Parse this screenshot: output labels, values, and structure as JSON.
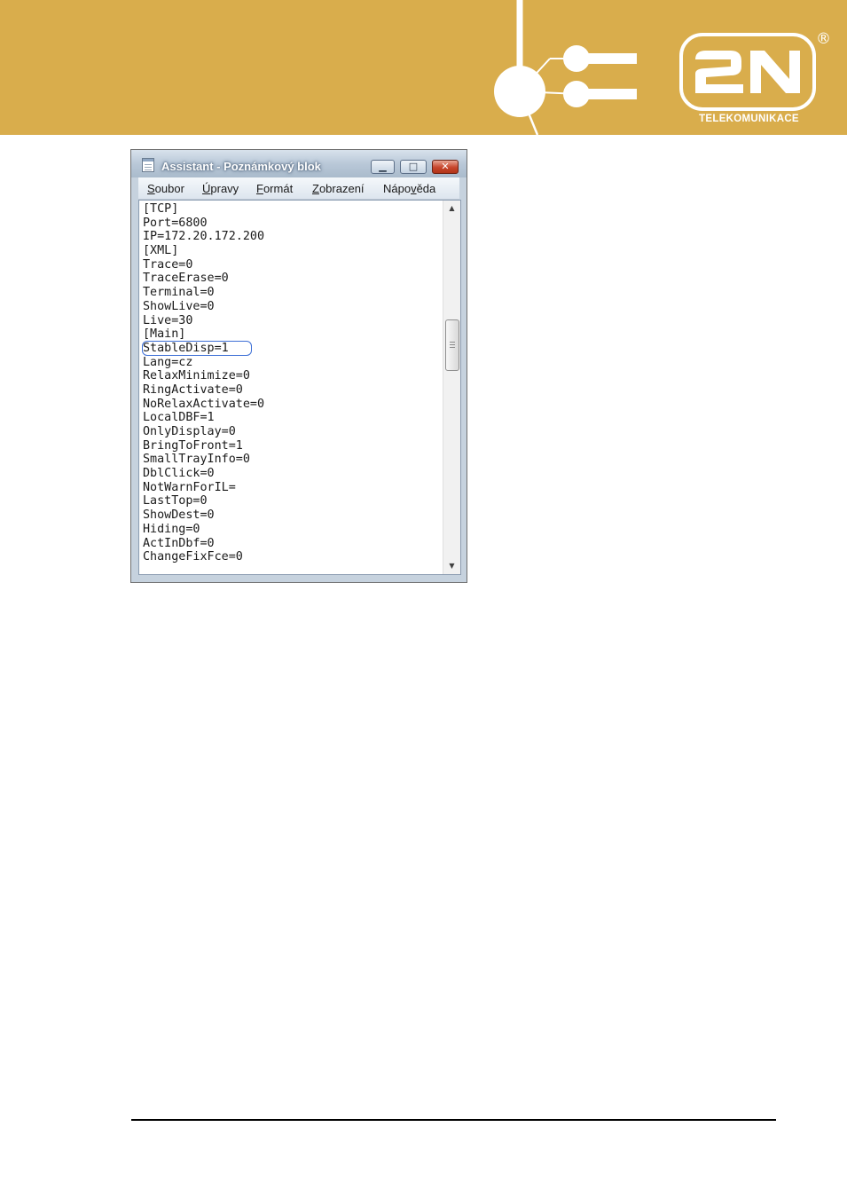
{
  "header": {
    "brand_registered": "®",
    "brand_subtitle": "TELEKOMUNIKACE",
    "brand_logo": "2N",
    "logo_icon": "2n-logo-icon",
    "circuit_icon": "circuit-nodes-icon",
    "colors": {
      "banner": "#d9ad4c",
      "logo": "#ffffff"
    }
  },
  "window": {
    "title": "Assistant - Poznámkový blok",
    "app_icon": "notepad-icon",
    "controls": {
      "minimize_icon": "minimize-icon",
      "maximize_icon": "maximize-icon",
      "close_icon": "close-icon"
    },
    "menu": [
      {
        "key": "S",
        "rest": "oubor"
      },
      {
        "key": "Ú",
        "rest": "pravy"
      },
      {
        "key": "F",
        "rest": "ormát"
      },
      {
        "key": "Z",
        "rest": "obrazení"
      },
      {
        "pre": "Nápo",
        "key": "v",
        "rest": "ěda"
      }
    ],
    "lines": [
      "[TCP]",
      "Port=6800",
      "IP=172.20.172.200",
      "[XML]",
      "Trace=0",
      "TraceErase=0",
      "Terminal=0",
      "ShowLive=0",
      "Live=30",
      "[Main]",
      "StableDisp=1",
      "Lang=cz",
      "RelaxMinimize=0",
      "RingActivate=0",
      "NoRelaxActivate=0",
      "LocalDBF=1",
      "OnlyDisplay=0",
      "BringToFront=1",
      "SmallTrayInfo=0",
      "DblClick=0",
      "NotWarnForIL=",
      "LastTop=0",
      "ShowDest=0",
      "Hiding=0",
      "ActInDbf=0",
      "ChangeFixFce=0"
    ],
    "highlighted_line": "StableDisp=1",
    "highlight_color": "#3d6fd6",
    "scrollbar": {
      "up_icon": "scroll-up-arrow-icon",
      "down_icon": "scroll-down-arrow-icon"
    }
  }
}
